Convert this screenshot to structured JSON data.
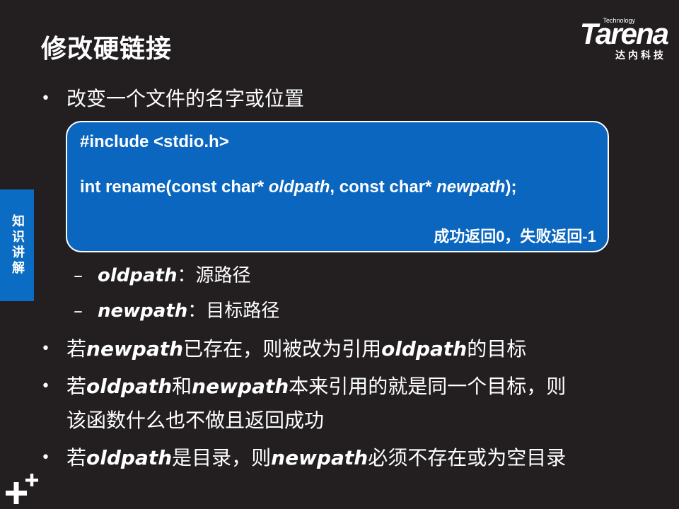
{
  "slide": {
    "title": "修改硬链接",
    "side_tab": "知识讲解"
  },
  "logo": {
    "tech": "Technology",
    "word": "Tarena",
    "cn": "达内科技"
  },
  "bullet1": {
    "text": "改变一个文件的名字或位置"
  },
  "code": {
    "line1": "#include <stdio.h>",
    "line2_a": "int rename(const char* ",
    "line2_b": "oldpath",
    "line2_c": ", const char* ",
    "line2_d": "newpath",
    "line2_e": ");",
    "return": "成功返回0，失败返回-1"
  },
  "sub1": {
    "em": "oldpath",
    "text": "：源路径"
  },
  "sub2": {
    "em": "newpath",
    "text": "：目标路径"
  },
  "bullet2": {
    "a": "若",
    "em1": "newpath",
    "b": "已存在，则被改为引用",
    "em2": "oldpath",
    "c": "的目标"
  },
  "bullet3": {
    "a": "若",
    "em1": "oldpath",
    "b": "和",
    "em2": "newpath",
    "c": "本来引用的就是同一个目标，则",
    "line2": "该函数什么也不做且返回成功"
  },
  "bullet4": {
    "a": "若",
    "em1": "oldpath",
    "b": "是目录，则",
    "em2": "newpath",
    "c": "必须不存在或为空目录"
  },
  "icons": {
    "bullet": "bullet-dot",
    "dash": "dash",
    "corner": "plus-icon"
  }
}
